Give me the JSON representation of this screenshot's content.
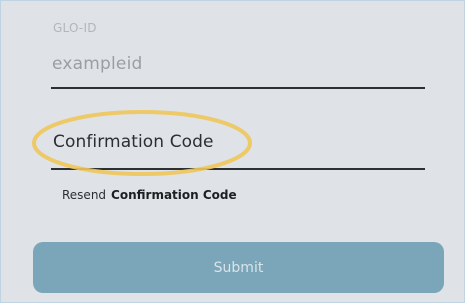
{
  "form": {
    "glo_id": {
      "label": "GLO-ID",
      "value": "exampleid"
    },
    "confirmation_code": {
      "value": "Confirmation Code"
    },
    "resend": {
      "prefix": "Resend",
      "action": "Confirmation Code"
    },
    "submit_label": "Submit"
  },
  "colors": {
    "panel_background": "#dfe2e6",
    "submit_button": "#7ba6b9",
    "highlight_ring": "#f0c75a"
  }
}
